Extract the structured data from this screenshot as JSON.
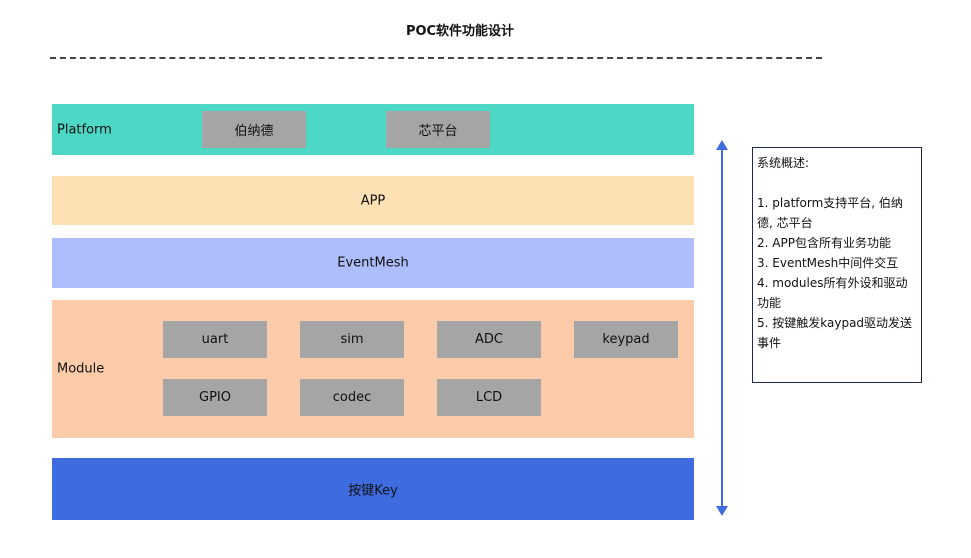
{
  "title": "POC软件功能设计",
  "layers": {
    "platform": {
      "label": "Platform",
      "items": [
        "伯纳德",
        "芯平台"
      ]
    },
    "app": {
      "label": "APP"
    },
    "eventmesh": {
      "label": "EventMesh"
    },
    "module": {
      "label": "Module",
      "items": [
        "uart",
        "sim",
        "ADC",
        "keypad",
        "GPIO",
        "codec",
        "LCD"
      ]
    },
    "key": {
      "label": "按键Key"
    }
  },
  "note": {
    "title": "系统概述:",
    "items": [
      "1. platform支持平台, 伯纳德, 芯平台",
      "2. APP包含所有业务功能",
      "3. EventMesh中间件交互",
      "4. modules所有外设和驱动功能",
      "5. 按键触发kaypad驱动发送事件"
    ]
  },
  "colors": {
    "platform": "#4dd8c6",
    "app": "#fde1b5",
    "eventmesh": "#aebdfc",
    "module": "#fccba9",
    "key": "#3e6be0",
    "box": "#a5a5a5",
    "arrow": "#3e6be0"
  },
  "icons": {
    "arrow": "double-headed-vertical-arrow-icon"
  }
}
